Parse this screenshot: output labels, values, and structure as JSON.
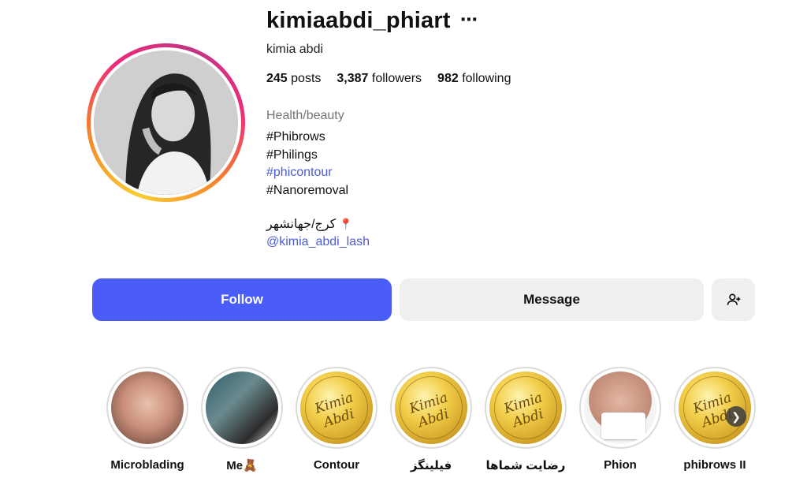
{
  "profile": {
    "username": "kimiaabdi_phiart",
    "more_icon": "⋯",
    "full_name": "kimia abdi",
    "stats": {
      "posts_count": "245",
      "posts_label": "posts",
      "followers_count": "3,387",
      "followers_label": "followers",
      "following_count": "982",
      "following_label": "following"
    },
    "category": "Health/beauty",
    "bio_lines": [
      "#Phibrows",
      "#Philings",
      "#phicontour",
      "#Nanoremoval"
    ],
    "location_pin": "📍",
    "location": "کرج/جهانشهر",
    "mention": "@kimia_abdi_lash"
  },
  "actions": {
    "follow_label": "Follow",
    "message_label": "Message",
    "add_user_icon": "person-add-icon"
  },
  "highlights": [
    {
      "label": "Microblading"
    },
    {
      "label": "Me🧸"
    },
    {
      "label": "Contour"
    },
    {
      "label": "فیلینگز"
    },
    {
      "label": "رضایت شماها"
    },
    {
      "label": "Phion"
    },
    {
      "label": "phibrows II"
    }
  ],
  "colors": {
    "accent_blue": "#4a5df9",
    "link_blue": "#4a5cdb",
    "secondary_button": "#efefef",
    "category_gray": "#737373"
  }
}
